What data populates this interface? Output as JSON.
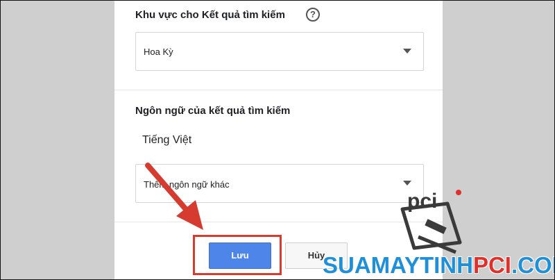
{
  "region_section": {
    "title": "Khu vực cho Kết quả tìm kiếm",
    "help_icon": "?",
    "selected_region": "Hoa Kỳ"
  },
  "language_section": {
    "title": "Ngôn ngữ của kết quả tìm kiếm",
    "current_language": "Tiếng Việt",
    "add_language_label": "Thêm ngôn ngữ khác"
  },
  "actions": {
    "save_label": "Lưu",
    "cancel_label": "Hủy"
  },
  "watermark": {
    "part1": "SUAMAYTINH",
    "part2": "PCI",
    "part3": ".COM",
    "logo_text": "pci"
  },
  "colors": {
    "save_button": "#4d86e8",
    "annotation_red": "#d63b2f",
    "watermark_blue": "#1f8fd8",
    "watermark_red": "#e0302a"
  }
}
